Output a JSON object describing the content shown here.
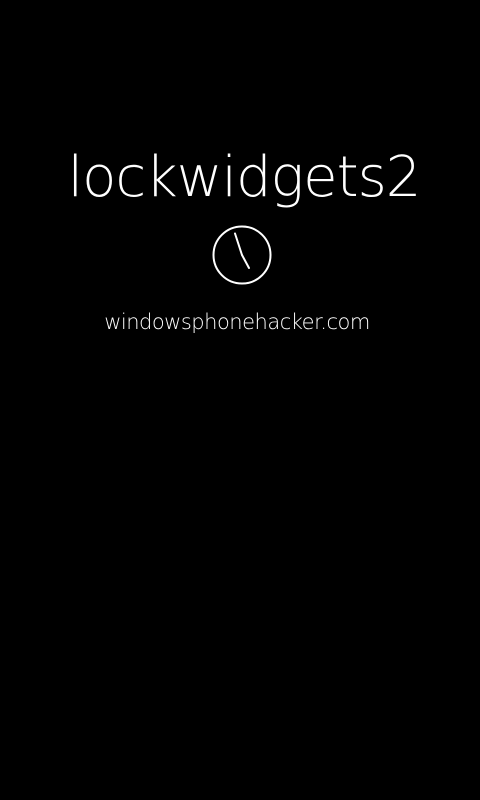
{
  "splash": {
    "title": "lockwidgets2",
    "icon": "clock-icon",
    "website": "windowsphonehacker.com"
  },
  "colors": {
    "background": "#000000",
    "foreground": "#ffffff"
  }
}
